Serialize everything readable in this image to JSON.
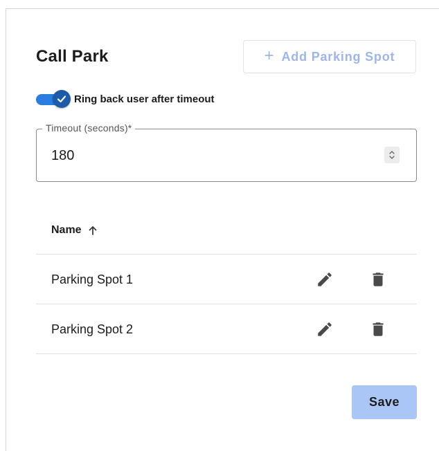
{
  "page": {
    "title": "Call Park"
  },
  "actions": {
    "add_parking_spot_label": "Add Parking Spot",
    "add_icon": "plus-icon",
    "save_label": "Save"
  },
  "ring_back": {
    "label": "Ring back user after timeout",
    "enabled": true
  },
  "timeout_field": {
    "label": "Timeout (seconds)*",
    "value": "180"
  },
  "table": {
    "columns": [
      {
        "label": "Name",
        "sort": "ascending",
        "sort_icon": "arrow-up-icon"
      }
    ],
    "rows": [
      {
        "name": "Parking Spot 1",
        "actions": [
          "edit-icon",
          "delete-icon"
        ]
      },
      {
        "name": "Parking Spot 2",
        "actions": [
          "edit-icon",
          "delete-icon"
        ]
      }
    ]
  },
  "colors": {
    "primary": "#2a7de1",
    "toggle_thumb": "#1e5ba8",
    "save_button_bg": "#a9c6f7",
    "add_button_text": "#9db5ee",
    "icon": "#4a4a4a"
  }
}
